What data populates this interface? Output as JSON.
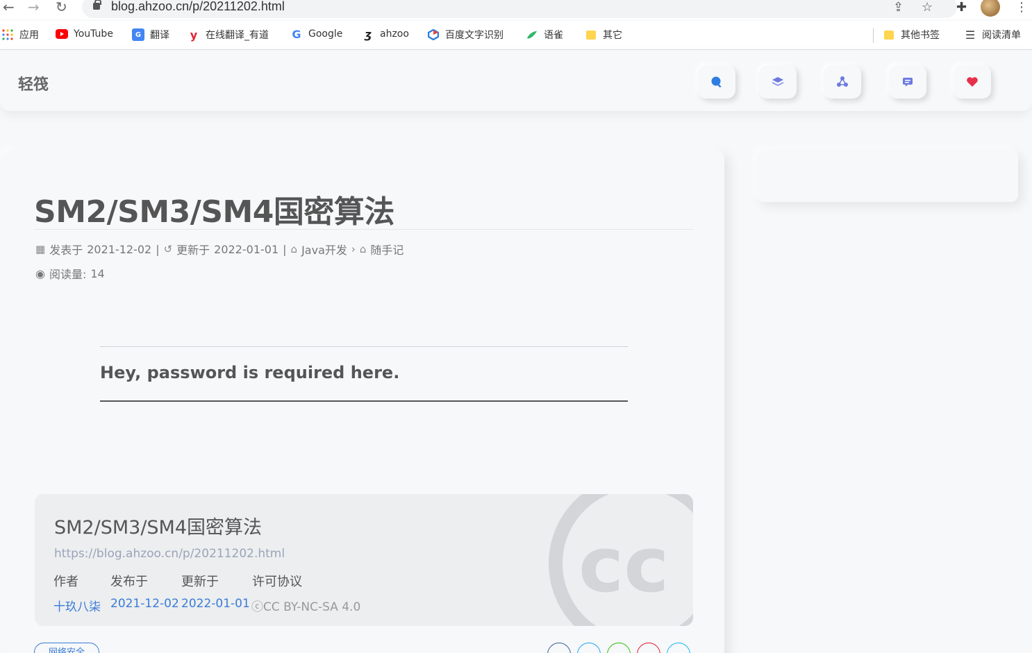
{
  "browser": {
    "url": "blog.ahzoo.cn/p/20211202.html",
    "bookmarks": [
      {
        "label": "应用",
        "icon": "apps-grid-icon"
      },
      {
        "label": "YouTube",
        "icon": "youtube-icon"
      },
      {
        "label": "翻译",
        "icon": "translate-icon"
      },
      {
        "label": "在线翻译_有道",
        "icon": "youdao-icon"
      },
      {
        "label": "Google",
        "icon": "google-icon"
      },
      {
        "label": "ahzoo",
        "icon": "ahzoo-icon"
      },
      {
        "label": "百度文字识别",
        "icon": "baidu-ocr-icon"
      },
      {
        "label": "语雀",
        "icon": "yuque-icon"
      },
      {
        "label": "其它",
        "icon": "folder-icon"
      }
    ],
    "other_bookmarks": "其他书签",
    "reading_list": "阅读清单"
  },
  "site": {
    "brand": "轻筏",
    "header_buttons": [
      {
        "name": "search-icon",
        "color": "#2f7de1"
      },
      {
        "name": "layers-icon",
        "color": "#6c7ae0"
      },
      {
        "name": "share-nodes-icon",
        "color": "#6c7ae0"
      },
      {
        "name": "chat-icon",
        "color": "#6c7ae0"
      },
      {
        "name": "heart-icon",
        "color": "#e8304a"
      }
    ]
  },
  "post": {
    "title": "SM2/SM3/SM4国密算法",
    "published_label": "发表于",
    "published": "2021-12-02",
    "updated_label": "更新于",
    "updated": "2022-01-01",
    "category1": "Java开发",
    "category2": "随手记",
    "views_label": "阅读量:",
    "views": "14",
    "password_prompt": "Hey, password is required here."
  },
  "copyright": {
    "title": "SM2/SM3/SM4国密算法",
    "link": "https://blog.ahzoo.cn/p/20211202.html",
    "author_label": "作者",
    "published_label": "发布于",
    "updated_label": "更新于",
    "license_label": "许可协议",
    "author": "十玖八柒",
    "published": "2021-12-02",
    "updated": "2022-01-01",
    "license": "CC BY-NC-SA 4.0"
  },
  "tags": [
    "网络安全"
  ]
}
